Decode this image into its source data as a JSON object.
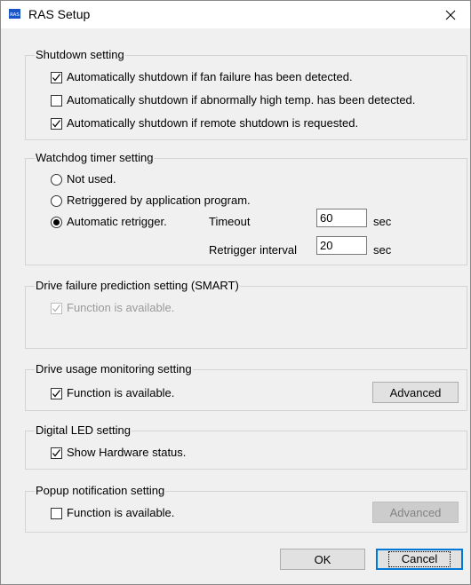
{
  "window": {
    "title": "RAS Setup",
    "icon_text": "RAS"
  },
  "shutdown": {
    "title": "Shutdown setting",
    "fan_failure": "Automatically shutdown if fan failure has been detected.",
    "high_temp": "Automatically shutdown if abnormally high temp. has been detected.",
    "remote": "Automatically shutdown if remote shutdown is requested."
  },
  "watchdog": {
    "title": "Watchdog timer setting",
    "not_used": "Not used.",
    "retriggered_app": "Retriggered by application program.",
    "automatic": "Automatic retrigger.",
    "timeout_label": "Timeout",
    "timeout_value": "60",
    "timeout_unit": "sec",
    "interval_label": "Retrigger interval",
    "interval_value": "20",
    "interval_unit": "sec"
  },
  "smart": {
    "title": "Drive failure prediction setting (SMART)",
    "function_label": "Function is available."
  },
  "drive_usage": {
    "title": "Drive usage monitoring setting",
    "function_label": "Function is available.",
    "advanced_label": "Advanced"
  },
  "digital_led": {
    "title": "Digital LED setting",
    "show_status": "Show Hardware status."
  },
  "popup": {
    "title": "Popup notification setting",
    "function_label": "Function is available.",
    "advanced_label": "Advanced"
  },
  "footer": {
    "ok_label": "OK",
    "cancel_label": "Cancel"
  }
}
